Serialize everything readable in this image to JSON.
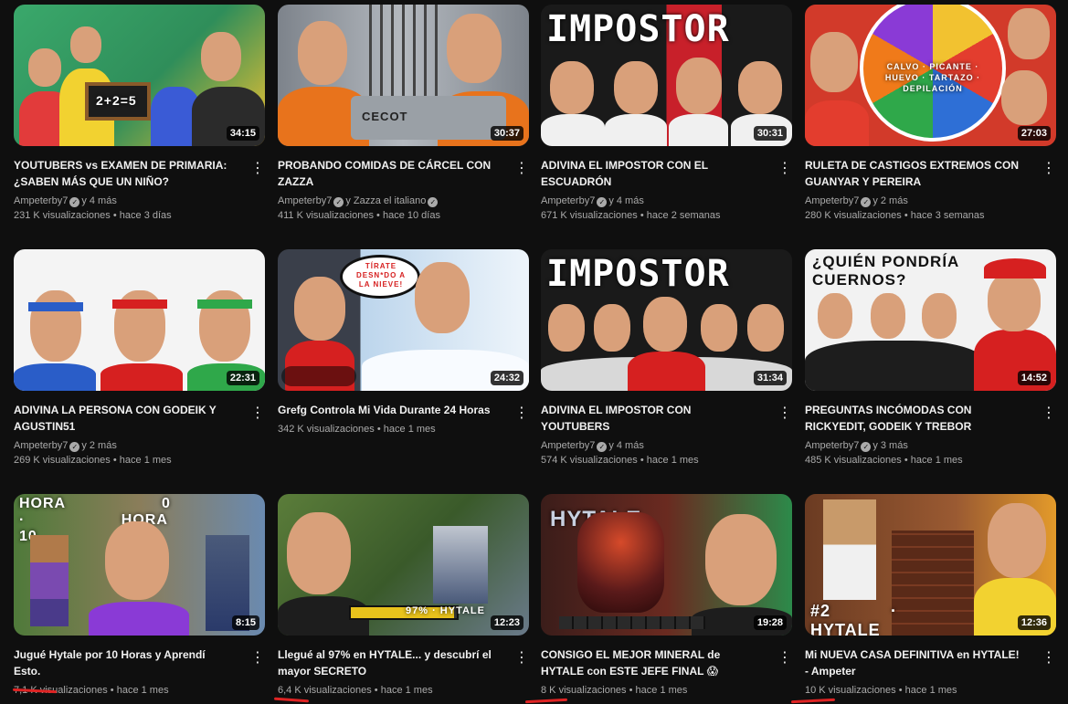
{
  "videos": [
    {
      "title": "YOUTUBERS vs EXAMEN DE PRIMARIA: ¿SABEN MÁS QUE UN NIÑO?",
      "channel": "Ampeterby7",
      "collab": "y 4 más",
      "views": "231 K visualizaciones",
      "age": "hace 3 días",
      "duration": "34:15",
      "thumb_text": "2+2=5",
      "colors": [
        "#3aa86b",
        "#f2c230"
      ]
    },
    {
      "title": "PROBANDO COMIDAS DE CÁRCEL CON ZAZZA",
      "channel": "Ampeterby7",
      "collab": "y Zazza el italiano",
      "views": "411 K visualizaciones",
      "age": "hace 10 días",
      "duration": "30:37",
      "thumb_text": "CECOT",
      "colors": [
        "#8a8f96",
        "#e8731c"
      ]
    },
    {
      "title": "ADIVINA EL IMPOSTOR CON EL ESCUADRÓN",
      "channel": "Ampeterby7",
      "collab": "y 4 más",
      "views": "671 K visualizaciones",
      "age": "hace 2 semanas",
      "duration": "30:31",
      "thumb_text": "IMPOSTOR",
      "colors": [
        "#1a1a1a",
        "#c8202a"
      ]
    },
    {
      "title": "RULETA DE CASTIGOS EXTREMOS CON GUANYAR Y PEREIRA",
      "channel": "Ampeterby7",
      "collab": "y 2 más",
      "views": "280 K visualizaciones",
      "age": "hace 3 semanas",
      "duration": "27:03",
      "thumb_text": "CALVO · PICANTE · HUEVO · TARTAZO · DEPILACIÓN",
      "colors": [
        "#2e6fd6",
        "#e33d2e"
      ]
    },
    {
      "title": "ADIVINA LA PERSONA CON GODEIK Y AGUSTIN51",
      "channel": "Ampeterby7",
      "collab": "y 2 más",
      "views": "269 K visualizaciones",
      "age": "hace 1 mes",
      "duration": "22:31",
      "thumb_text": "",
      "colors": [
        "#f4f4f4",
        "#2a5dc8"
      ]
    },
    {
      "title": "Grefg Controla Mi Vida Durante 24 Horas",
      "channel": "",
      "collab": "",
      "views": "342 K visualizaciones",
      "age": "hace 1 mes",
      "duration": "24:32",
      "thumb_text": "TÍRATE DESN*DO A LA NIEVE!",
      "colors": [
        "#3a3f4a",
        "#a9c8e6"
      ]
    },
    {
      "title": "ADIVINA EL IMPOSTOR CON YOUTUBERS",
      "channel": "Ampeterby7",
      "collab": "y 4 más",
      "views": "574 K visualizaciones",
      "age": "hace 1 mes",
      "duration": "31:34",
      "thumb_text": "IMPOSTOR",
      "colors": [
        "#1a1a1a",
        "#d8d8d8"
      ]
    },
    {
      "title": "PREGUNTAS INCÓMODAS CON RICKYEDIT, GODEIK Y TREBOR",
      "channel": "Ampeterby7",
      "collab": "y 3 más",
      "views": "485 K visualizaciones",
      "age": "hace 1 mes",
      "duration": "14:52",
      "thumb_text": "¿QUIÉN PONDRÍA CUERNOS?",
      "colors": [
        "#f2f2f2",
        "#d62020"
      ]
    },
    {
      "title": "Jugué Hytale por 10 Horas y Aprendí Esto.",
      "channel": "",
      "collab": "",
      "views": "7,1 K visualizaciones",
      "age": "hace 1 mes",
      "duration": "8:15",
      "thumb_text": "HORA 0 · HORA 10",
      "colors": [
        "#4f7a3a",
        "#6a5aa8"
      ]
    },
    {
      "title": "Llegué al 97% en HYTALE... y descubrí el mayor SECRETO",
      "channel": "",
      "collab": "",
      "views": "6,4 K visualizaciones",
      "age": "hace 1 mes",
      "duration": "12:23",
      "thumb_text": "97% · HYTALE",
      "colors": [
        "#5b7d3a",
        "#e8c21c"
      ]
    },
    {
      "title": "CONSIGO EL MEJOR MINERAL de HYTALE con ESTE JEFE FINAL 😱",
      "channel": "",
      "collab": "",
      "views": "8 K visualizaciones",
      "age": "hace 1 mes",
      "duration": "19:28",
      "thumb_text": "HYTALE",
      "colors": [
        "#3b1d1a",
        "#2c8a4a"
      ]
    },
    {
      "title": "Mi NUEVA CASA DEFINITIVA en HYTALE! - Ampeter",
      "channel": "",
      "collab": "",
      "views": "10 K visualizaciones",
      "age": "hace 1 mes",
      "duration": "12:36",
      "thumb_text": "#2 · HYTALE",
      "colors": [
        "#6b3b22",
        "#e39a2a"
      ]
    }
  ],
  "menu_icon": "more-vert-icon",
  "verified_icon": "verified-check-icon",
  "separator": "•",
  "annotation_color": "#e02424"
}
